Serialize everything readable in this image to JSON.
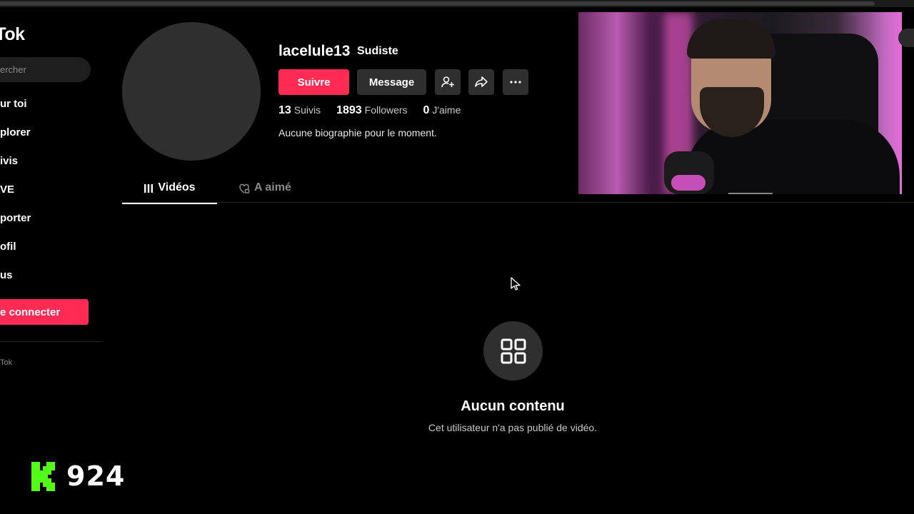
{
  "sidebar": {
    "logo": "kTok",
    "search_placeholder": "ercher",
    "items": [
      {
        "label": "ur toi"
      },
      {
        "label": "plorer"
      },
      {
        "label": "ivis"
      },
      {
        "label": "VE"
      },
      {
        "label": "porter"
      },
      {
        "label": "ofil"
      },
      {
        "label": "us"
      }
    ],
    "login_label": "e connecter",
    "footer": "Tok"
  },
  "profile": {
    "username": "lacelule13",
    "nickname": "Sudiste",
    "follow_label": "Suivre",
    "message_label": "Message",
    "stats": {
      "following_count": "13",
      "following_label": "Suivis",
      "followers_count": "1893",
      "followers_label": "Followers",
      "likes_count": "0",
      "likes_label": "J'aime"
    },
    "bio": "Aucune biographie pour le moment."
  },
  "tabs": {
    "videos": "Vidéos",
    "liked": "A aimé"
  },
  "empty_state": {
    "title": "Aucun contenu",
    "subtitle": "Cet utilisateur n'a pas publié de vidéo."
  },
  "kick": {
    "count": "924",
    "brand_color": "#53fc18"
  },
  "colors": {
    "accent": "#fe2c55",
    "background": "#000000",
    "button_gray": "#2f2f2f"
  }
}
